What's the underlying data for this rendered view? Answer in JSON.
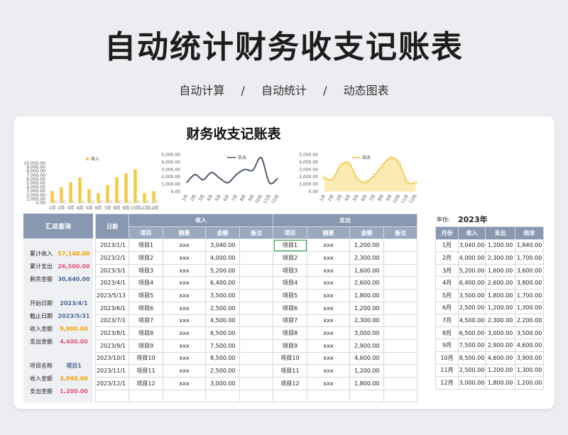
{
  "page": {
    "title": "自动统计财务收支记账表",
    "subtitle_items": [
      "自动计算",
      "自动统计",
      "动态图表"
    ],
    "subtitle_sep": "/"
  },
  "sheet": {
    "title": "财务收支记账表"
  },
  "chart_data": [
    {
      "type": "bar",
      "legend": "收入",
      "categories": [
        "1月",
        "2月",
        "3月",
        "4月",
        "5月",
        "6月",
        "7月",
        "8月",
        "9月",
        "10月",
        "11月",
        "12月"
      ],
      "values": [
        3040,
        4000,
        5200,
        6400,
        3500,
        2500,
        4500,
        6500,
        7500,
        8500,
        2500,
        3000
      ],
      "ylim": [
        0,
        10000
      ],
      "yticks": [
        "0.00",
        "1,000.00",
        "2,000.00",
        "3,000.00",
        "4,000.00",
        "5,000.00",
        "6,000.00",
        "7,000.00",
        "8,000.00",
        "9,000.00",
        "10,000.00"
      ],
      "color": "#f2cb4a"
    },
    {
      "type": "line",
      "legend": "支出",
      "categories": [
        "1月",
        "2月",
        "3月",
        "4月",
        "5月",
        "6月",
        "7月",
        "8月",
        "9月",
        "10月",
        "11月",
        "12月"
      ],
      "values": [
        1200,
        2300,
        1600,
        2600,
        1800,
        1200,
        2300,
        3000,
        2900,
        4600,
        1200,
        1800
      ],
      "ylim": [
        0,
        5000
      ],
      "yticks": [
        "0.00",
        "1,000.00",
        "2,000.00",
        "3,000.00",
        "4,000.00",
        "5,000.00"
      ],
      "color": "#4f5b6e"
    },
    {
      "type": "area",
      "legend": "结余",
      "categories": [
        "1月",
        "2月",
        "3月",
        "4月",
        "5月",
        "6月",
        "7月",
        "8月",
        "9月",
        "10月",
        "11月",
        "12月"
      ],
      "values": [
        1840,
        1700,
        3600,
        3800,
        1700,
        1300,
        2200,
        3500,
        4600,
        3900,
        1300,
        1200
      ],
      "ylim": [
        0,
        5000
      ],
      "yticks": [
        "0.00",
        "1,000.00",
        "2,000.00",
        "3,000.00",
        "4,000.00",
        "5,000.00"
      ],
      "color": "#f0c23a"
    }
  ],
  "summary": {
    "header": "汇总查询",
    "rows": [
      {
        "label": "累计收入",
        "value": "57,140.00",
        "color": "#f0a500"
      },
      {
        "label": "累计支出",
        "value": "26,500.00",
        "color": "#e0557a"
      },
      {
        "label": "剩余金额",
        "value": "30,640.00",
        "color": "#4a6a96"
      },
      {
        "label": "开始日期",
        "value": "2023/4/1",
        "color": "#4a6a96"
      },
      {
        "label": "截止日期",
        "value": "2023/5/31",
        "color": "#4a6a96"
      },
      {
        "label": "收入金额",
        "value": "9,900.00",
        "color": "#f0a500"
      },
      {
        "label": "支出金额",
        "value": "4,400.00",
        "color": "#e0557a"
      },
      {
        "label": "项目名称",
        "value": "项目1",
        "color": "#4a6a96"
      },
      {
        "label": "收入金额",
        "value": "3,040.00",
        "color": "#f0a500"
      },
      {
        "label": "支出金额",
        "value": "1,200.00",
        "color": "#e0557a"
      }
    ]
  },
  "table": {
    "date_header": "日期",
    "income_header": "收入",
    "expense_header": "支出",
    "sub_headers": [
      "项目",
      "摘要",
      "金额",
      "备注"
    ],
    "rows": [
      {
        "date": "2023/1/1",
        "in_item": "项目1",
        "in_desc": "xxx",
        "in_amt": "3,040.00",
        "in_note": "",
        "ex_item": "项目1",
        "ex_desc": "xxx",
        "ex_amt": "1,200.00",
        "ex_note": ""
      },
      {
        "date": "2023/2/1",
        "in_item": "项目2",
        "in_desc": "xxx",
        "in_amt": "4,000.00",
        "in_note": "",
        "ex_item": "项目2",
        "ex_desc": "xxx",
        "ex_amt": "2,300.00",
        "ex_note": ""
      },
      {
        "date": "2023/3/1",
        "in_item": "项目3",
        "in_desc": "xxx",
        "in_amt": "5,200.00",
        "in_note": "",
        "ex_item": "项目3",
        "ex_desc": "xxx",
        "ex_amt": "1,600.00",
        "ex_note": ""
      },
      {
        "date": "2023/4/1",
        "in_item": "项目4",
        "in_desc": "xxx",
        "in_amt": "6,400.00",
        "in_note": "",
        "ex_item": "项目4",
        "ex_desc": "xxx",
        "ex_amt": "2,600.00",
        "ex_note": ""
      },
      {
        "date": "2023/5/13",
        "in_item": "项目5",
        "in_desc": "xxx",
        "in_amt": "3,500.00",
        "in_note": "",
        "ex_item": "项目5",
        "ex_desc": "xxx",
        "ex_amt": "1,800.00",
        "ex_note": ""
      },
      {
        "date": "2023/6/1",
        "in_item": "项目6",
        "in_desc": "xxx",
        "in_amt": "2,500.00",
        "in_note": "",
        "ex_item": "项目6",
        "ex_desc": "xxx",
        "ex_amt": "1,200.00",
        "ex_note": ""
      },
      {
        "date": "2023/7/1",
        "in_item": "项目7",
        "in_desc": "xxx",
        "in_amt": "4,500.00",
        "in_note": "",
        "ex_item": "项目7",
        "ex_desc": "xxx",
        "ex_amt": "2,300.00",
        "ex_note": ""
      },
      {
        "date": "2023/8/1",
        "in_item": "项目8",
        "in_desc": "xxx",
        "in_amt": "6,500.00",
        "in_note": "",
        "ex_item": "项目8",
        "ex_desc": "xxx",
        "ex_amt": "3,000.00",
        "ex_note": ""
      },
      {
        "date": "2023/9/1",
        "in_item": "项目9",
        "in_desc": "xxx",
        "in_amt": "7,500.00",
        "in_note": "",
        "ex_item": "项目9",
        "ex_desc": "xxx",
        "ex_amt": "2,900.00",
        "ex_note": ""
      },
      {
        "date": "2023/10/1",
        "in_item": "项目10",
        "in_desc": "xxx",
        "in_amt": "8,500.00",
        "in_note": "",
        "ex_item": "项目10",
        "ex_desc": "xxx",
        "ex_amt": "4,600.00",
        "ex_note": ""
      },
      {
        "date": "2023/11/1",
        "in_item": "项目11",
        "in_desc": "xxx",
        "in_amt": "2,500.00",
        "in_note": "",
        "ex_item": "项目11",
        "ex_desc": "xxx",
        "ex_amt": "1,200.00",
        "ex_note": ""
      },
      {
        "date": "2023/12/1",
        "in_item": "项目12",
        "in_desc": "xxx",
        "in_amt": "3,000.00",
        "in_note": "",
        "ex_item": "项目12",
        "ex_desc": "xxx",
        "ex_amt": "1,800.00",
        "ex_note": ""
      },
      {
        "date": "",
        "in_item": "",
        "in_desc": "",
        "in_amt": "",
        "in_note": "",
        "ex_item": "",
        "ex_desc": "",
        "ex_amt": "",
        "ex_note": ""
      }
    ]
  },
  "year_table": {
    "year_label": "年份:",
    "year": "2023年",
    "headers": [
      "月份",
      "收入",
      "支出",
      "结余"
    ],
    "rows": [
      [
        "1月",
        "3,040.00",
        "1,200.00",
        "1,840.00"
      ],
      [
        "2月",
        "4,000.00",
        "2,300.00",
        "1,700.00"
      ],
      [
        "3月",
        "5,200.00",
        "1,600.00",
        "3,600.00"
      ],
      [
        "4月",
        "6,400.00",
        "2,600.00",
        "3,800.00"
      ],
      [
        "5月",
        "3,500.00",
        "1,800.00",
        "1,700.00"
      ],
      [
        "6月",
        "2,500.00",
        "1,200.00",
        "1,300.00"
      ],
      [
        "7月",
        "4,500.00",
        "2,300.00",
        "2,200.00"
      ],
      [
        "8月",
        "6,500.00",
        "3,000.00",
        "3,500.00"
      ],
      [
        "9月",
        "7,500.00",
        "2,900.00",
        "4,600.00"
      ],
      [
        "10月",
        "8,500.00",
        "4,600.00",
        "3,900.00"
      ],
      [
        "11月",
        "2,500.00",
        "1,200.00",
        "1,300.00"
      ],
      [
        "12月",
        "3,000.00",
        "1,800.00",
        "1,200.00"
      ]
    ]
  }
}
